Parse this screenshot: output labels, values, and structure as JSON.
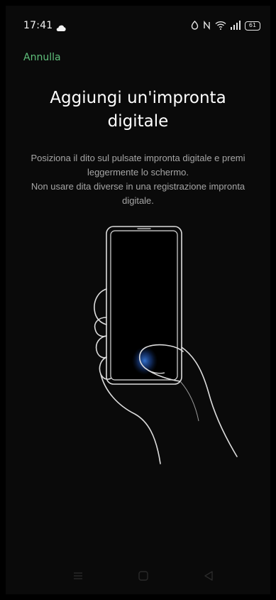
{
  "status_bar": {
    "time": "17:41",
    "battery": "61",
    "icons": [
      "cloud-icon",
      "alarm-icon",
      "nfc-icon",
      "wifi-icon",
      "signal-icon",
      "battery-icon"
    ]
  },
  "header": {
    "cancel_label": "Annulla"
  },
  "main": {
    "title": "Aggiungi un'impronta digitale",
    "instruction_1": "Posiziona il dito sul pulsate impronta digitale e premi leggermente lo schermo.",
    "instruction_2": "Non usare dita diverse in una registrazione impronta digitale."
  },
  "illustration": {
    "icon": "hand-holding-phone-illustration"
  },
  "nav_bar": {
    "icons": [
      "menu-icon",
      "home-icon",
      "back-icon"
    ]
  },
  "colors": {
    "accent": "#5fbf7b",
    "background": "#0a0a0a",
    "text_primary": "#ffffff",
    "text_secondary": "#a6a6a6",
    "fingerprint_glow": "#2d6fd6"
  }
}
